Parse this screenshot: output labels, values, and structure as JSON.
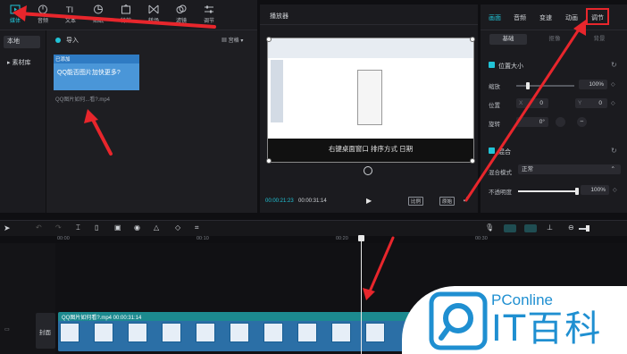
{
  "toolbar": {
    "items": [
      {
        "label": "媒体",
        "icon": "media-icon",
        "active": true
      },
      {
        "label": "音频",
        "icon": "audio-icon"
      },
      {
        "label": "文本",
        "icon": "text-icon"
      },
      {
        "label": "贴纸",
        "icon": "sticker-icon"
      },
      {
        "label": "特效",
        "icon": "effects-icon"
      },
      {
        "label": "转场",
        "icon": "transition-icon"
      },
      {
        "label": "滤镜",
        "icon": "filter-icon"
      },
      {
        "label": "调节",
        "icon": "adjust-icon"
      }
    ]
  },
  "media_side": {
    "local": "本地",
    "library": "素材库"
  },
  "media_main": {
    "import_label": "导入",
    "view_label": "宫格",
    "thumb_title": "QQ能否图片加快更多?",
    "thumb_caption": "QQ图片如何...看?.mp4",
    "thumb_tag": "已添加"
  },
  "player": {
    "title": "播放器",
    "subtitle": "右键桌面窗口 排序方式 日期",
    "time_current": "00:00:21:23",
    "time_total": "00:00:31:14",
    "btn_fit": "比例",
    "btn_original": "原始"
  },
  "right_panel": {
    "tabs": [
      "画面",
      "音频",
      "变速",
      "动画",
      "调节"
    ],
    "subtabs": [
      "基础",
      "抠像",
      "背景"
    ],
    "section_position": "位置大小",
    "scale_label": "缩放",
    "scale_value": "100%",
    "position_label": "位置",
    "pos_x_label": "X",
    "pos_x_value": "0",
    "pos_y_label": "Y",
    "pos_y_value": "0",
    "rotate_label": "旋转",
    "rotate_value": "0°",
    "section_blend": "混合",
    "blend_mode_label": "混合模式",
    "blend_mode_value": "正常",
    "opacity_label": "不透明度",
    "opacity_value": "100%",
    "scale_level": 0.2,
    "opacity_level": 1.0
  },
  "timeline": {
    "ticks": [
      "00:00",
      "00:10",
      "00:20",
      "00:30"
    ],
    "cover_label": "封面",
    "clip_title": "QQ图片如何看?.mp4  00:00:31:14"
  },
  "logo": {
    "brand": "PConline",
    "name": "IT百科"
  },
  "colors": {
    "accent": "#21c3d6",
    "annotation": "#e8262c"
  }
}
